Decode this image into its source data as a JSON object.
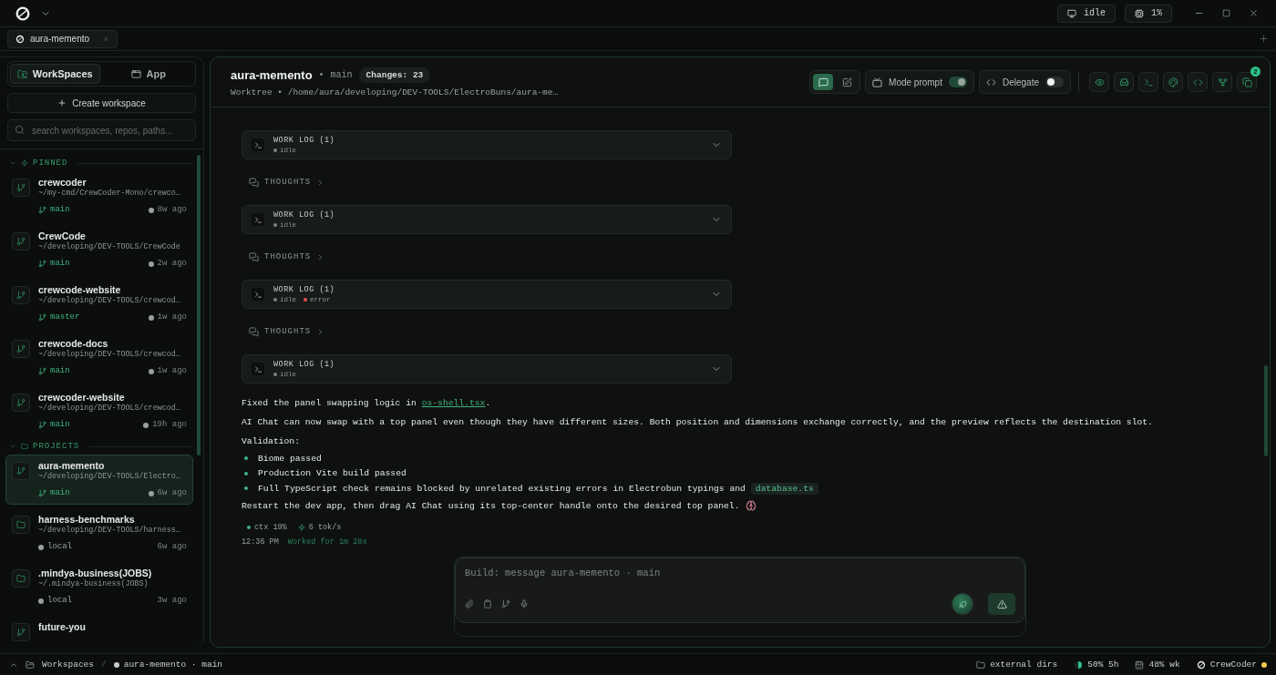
{
  "titlebar": {
    "status": "idle",
    "cpu": "1%"
  },
  "tabs": [
    {
      "label": "aura-memento",
      "selected": true
    }
  ],
  "sidebar": {
    "modes": [
      {
        "label": "WorkSpaces",
        "selected": true
      },
      {
        "label": "App",
        "selected": false
      }
    ],
    "create_button": "Create workspace",
    "search": {
      "placeholder": "search workspaces, repos, paths..."
    },
    "sections": [
      {
        "title": "PINNED",
        "items": [
          {
            "name": "crewcoder",
            "path": "~/my-cmd/CrewCoder-Mono/crewco…",
            "kind": "git",
            "branch": "main",
            "time": "8w ago",
            "selected": false
          },
          {
            "name": "CrewCode",
            "path": "~/developing/DEV-TOOLS/CrewCode",
            "kind": "git",
            "branch": "main",
            "time": "2w ago",
            "selected": false
          },
          {
            "name": "crewcode-website",
            "path": "~/developing/DEV-TOOLS/crewcod…",
            "kind": "git",
            "branch": "master",
            "time": "1w ago",
            "selected": false
          },
          {
            "name": "crewcode-docs",
            "path": "~/developing/DEV-TOOLS/crewcod…",
            "kind": "git",
            "branch": "main",
            "time": "1w ago",
            "selected": false
          },
          {
            "name": "crewcoder-website",
            "path": "~/developing/DEV-TOOLS/crewcod…",
            "kind": "git",
            "branch": "main",
            "time": "19h ago",
            "selected": false
          }
        ]
      },
      {
        "title": "PROJECTS",
        "items": [
          {
            "name": "aura-memento",
            "path": "~/developing/DEV-TOOLS/Electro…",
            "kind": "git",
            "branch": "main",
            "time": "6w ago",
            "selected": true
          },
          {
            "name": "harness-benchmarks",
            "path": "~/developing/DEV-TOOLS/harness…",
            "kind": "local",
            "branch": "local",
            "time": "6w ago",
            "selected": false
          },
          {
            "name": ".mindya-business(JOBS)",
            "path": "~/.mindya-business(JOBS)",
            "kind": "local",
            "branch": "local",
            "time": "3w ago",
            "selected": false
          },
          {
            "name": "future-you",
            "kind": "git",
            "selected": false
          }
        ]
      }
    ]
  },
  "header": {
    "title": "aura-memento",
    "separator": "•",
    "branch": "main",
    "changes": "Changes: 23",
    "subtitle": "Worktree • /home/aura/developing/DEV-TOOLS/ElectroBuns/aura-me…",
    "views": [
      {
        "kind": "chat",
        "selected": true
      },
      {
        "kind": "edit",
        "selected": false
      }
    ],
    "toggles": [
      {
        "label": "Mode prompt",
        "kind": "mode",
        "on": true
      },
      {
        "label": "Delegate",
        "kind": "delegate",
        "on": false
      }
    ],
    "tool_badge": "2"
  },
  "conversation": {
    "steps": [
      {
        "kind": "worklog",
        "title": "WORK LOG (1)",
        "statuses": [
          {
            "label": "idle",
            "color": "#7d8480"
          }
        ]
      },
      {
        "kind": "thoughts",
        "title": "THOUGHTS"
      },
      {
        "kind": "worklog",
        "title": "WORK LOG (1)",
        "statuses": [
          {
            "label": "idle",
            "color": "#7d8480"
          }
        ]
      },
      {
        "kind": "thoughts",
        "title": "THOUGHTS"
      },
      {
        "kind": "worklog",
        "title": "WORK LOG (1)",
        "statuses": [
          {
            "label": "idle",
            "color": "#7d8480"
          },
          {
            "label": "error",
            "color": "#e5534b"
          }
        ]
      },
      {
        "kind": "thoughts",
        "title": "THOUGHTS"
      },
      {
        "kind": "worklog",
        "title": "WORK LOG (1)",
        "statuses": [
          {
            "label": "idle",
            "color": "#7d8480"
          }
        ]
      }
    ],
    "message": [
      {
        "kind": "text",
        "text": "Fixed the panel swapping logic in ",
        "link": "os-shell.tsx",
        "after": "."
      },
      {
        "kind": "text",
        "text": "AI Chat can now swap with a top panel even though they have different sizes. Both position and dimensions exchange correctly, and the preview reflects the destination slot."
      },
      {
        "kind": "text",
        "text": "Validation:"
      },
      {
        "kind": "bullet",
        "text": "Biome passed"
      },
      {
        "kind": "bullet",
        "text": "Production Vite build passed"
      },
      {
        "kind": "bullet",
        "text": "Full TypeScript check remains blocked by unrelated existing errors in Electrobun typings and ",
        "code": "database.ts"
      },
      {
        "kind": "text",
        "text": "Restart the dev app, then drag AI Chat using its top-center handle onto the desired top panel.",
        "brain": true
      }
    ],
    "stats": {
      "context": "ctx 19%",
      "speed": "6 tok/s"
    },
    "time": "12:36 PM",
    "duration": "Worked for 1m 28s"
  },
  "composer": {
    "placeholder": "Build: message aura-memento · main"
  },
  "status_bar": {
    "root": "Workspaces",
    "separator": "/",
    "current": "aura-memento · main",
    "dirs": "external dirs",
    "session": "50% 5h",
    "week": "48% wk",
    "brand": "CrewCoder"
  }
}
